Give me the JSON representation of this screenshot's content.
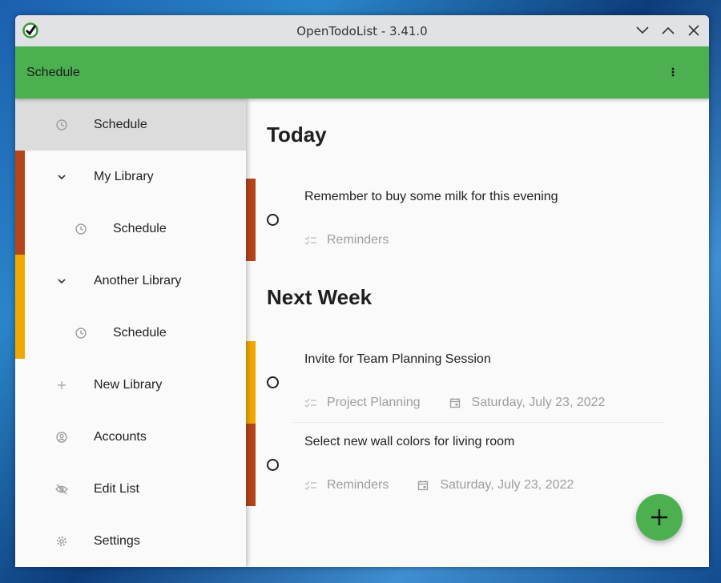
{
  "window": {
    "title": "OpenTodoList - 3.41.0",
    "controls": [
      "minimize",
      "maximize",
      "close"
    ]
  },
  "appbar": {
    "title": "Schedule",
    "menu_icon": "more-vert-icon"
  },
  "drawer": {
    "items": [
      {
        "label": "Schedule",
        "icon": "clock-icon",
        "active": true
      },
      {
        "label": "My Library",
        "icon": "chevron-down-icon",
        "color": "#b5451b"
      },
      {
        "label": "Schedule",
        "icon": "clock-icon",
        "color": "#b5451b",
        "sub": true
      },
      {
        "label": "Another Library",
        "icon": "chevron-down-icon",
        "color": "#f0a800"
      },
      {
        "label": "Schedule",
        "icon": "clock-icon",
        "color": "#f0a800",
        "sub": true
      },
      {
        "label": "New Library",
        "icon": "plus-icon"
      },
      {
        "label": "Accounts",
        "icon": "account-icon"
      },
      {
        "label": "Edit List",
        "icon": "eye-off-icon"
      },
      {
        "label": "Settings",
        "icon": "gear-icon"
      }
    ]
  },
  "main": {
    "sections": [
      {
        "title": "Today",
        "todos": [
          {
            "title": "Remember to buy some milk for this evening",
            "list": "Reminders",
            "date": "",
            "color": "#b5451b"
          }
        ]
      },
      {
        "title": "Next Week",
        "todos": [
          {
            "title": "Invite for Team Planning Session",
            "list": "Project Planning",
            "date": "Saturday, July 23, 2022",
            "color": "#f0a800"
          },
          {
            "title": "Select new wall colors for living room",
            "list": "Reminders",
            "date": "Saturday, July 23, 2022",
            "color": "#b5451b"
          }
        ]
      }
    ],
    "fab_icon": "plus-icon"
  },
  "colors": {
    "accent": "#4caf50",
    "library_red": "#b5451b",
    "library_yellow": "#f0a800"
  }
}
